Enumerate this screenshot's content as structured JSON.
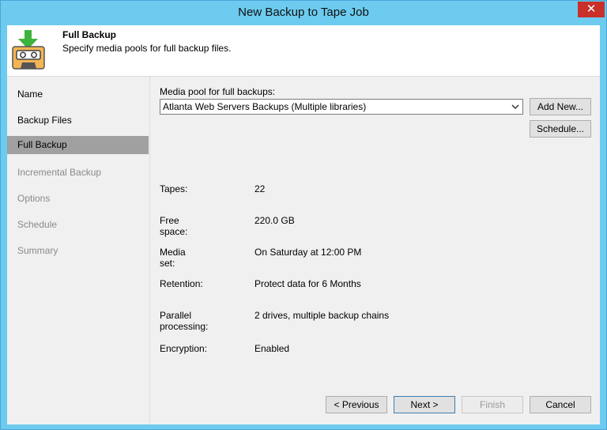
{
  "window": {
    "title": "New Backup to Tape Job",
    "close_glyph": "✕"
  },
  "header": {
    "title": "Full Backup",
    "subtitle": "Specify media pools for full backup files.",
    "icon": "tape-job-icon"
  },
  "nav": {
    "items": [
      {
        "label": "Name",
        "state": "done"
      },
      {
        "label": "Backup Files",
        "state": "done"
      },
      {
        "label": "Full Backup",
        "state": "active"
      },
      {
        "label": "Incremental Backup",
        "state": "disabled"
      },
      {
        "label": "Options",
        "state": "disabled"
      },
      {
        "label": "Schedule",
        "state": "disabled"
      },
      {
        "label": "Summary",
        "state": "disabled"
      }
    ]
  },
  "main": {
    "pool_label": "Media pool for full backups:",
    "pool_value": "Atlanta Web Servers Backups (Multiple libraries)",
    "add_new_label": "Add New...",
    "schedule_label": "Schedule...",
    "info": [
      {
        "key": "Tapes:",
        "value": "22"
      },
      {
        "key": "Free space:",
        "value": "220.0 GB"
      },
      {
        "key": "Media set:",
        "value": "On Saturday at 12:00 PM"
      },
      {
        "key": "Retention:",
        "value": "Protect data for 6 Months"
      },
      {
        "key": "Parallel processing:",
        "value": "2 drives, multiple backup chains"
      },
      {
        "key": "Encryption:",
        "value": "Enabled"
      }
    ]
  },
  "footer": {
    "previous_label": "< Previous",
    "next_label": "Next >",
    "finish_label": "Finish",
    "cancel_label": "Cancel"
  },
  "colors": {
    "titlebar": "#6ccbef",
    "close_button": "#c8302a",
    "nav_active": "#a0a0a0",
    "icon_green": "#3db33d"
  }
}
